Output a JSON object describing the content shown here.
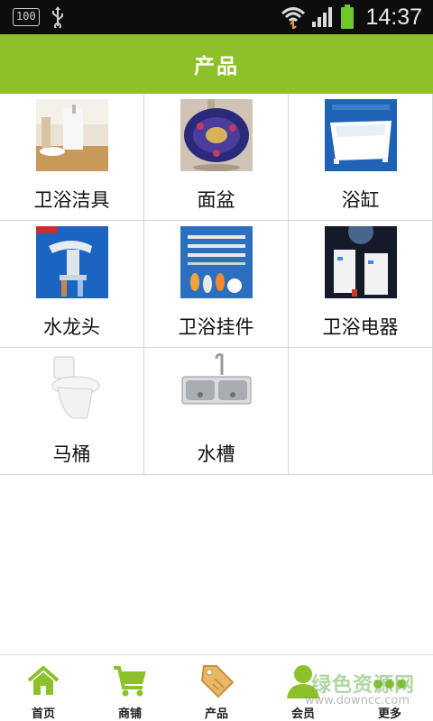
{
  "status_bar": {
    "battery_badge": "100",
    "time": "14:37"
  },
  "header": {
    "title": "产品"
  },
  "products": [
    {
      "label": "卫浴洁具",
      "icon": "bathroom-fixtures-thumb"
    },
    {
      "label": "面盆",
      "icon": "basin-thumb"
    },
    {
      "label": "浴缸",
      "icon": "bathtub-thumb"
    },
    {
      "label": "水龙头",
      "icon": "faucet-thumb"
    },
    {
      "label": "卫浴挂件",
      "icon": "bathroom-rack-thumb"
    },
    {
      "label": "卫浴电器",
      "icon": "bathroom-appliance-thumb"
    },
    {
      "label": "马桶",
      "icon": "toilet-thumb"
    },
    {
      "label": "水槽",
      "icon": "sink-thumb"
    }
  ],
  "bottom_nav": [
    {
      "label": "首页",
      "icon": "home-icon"
    },
    {
      "label": "商铺",
      "icon": "cart-icon"
    },
    {
      "label": "产品",
      "icon": "tag-icon"
    },
    {
      "label": "会员",
      "icon": "user-icon"
    },
    {
      "label": "更多",
      "icon": "more-icon"
    }
  ],
  "watermark": {
    "brand": "绿色资源网",
    "url": "www.downcc.com"
  },
  "colors": {
    "accent": "#8cc12a",
    "status_bar": "#0d0d0d",
    "battery": "#6fc82a"
  }
}
